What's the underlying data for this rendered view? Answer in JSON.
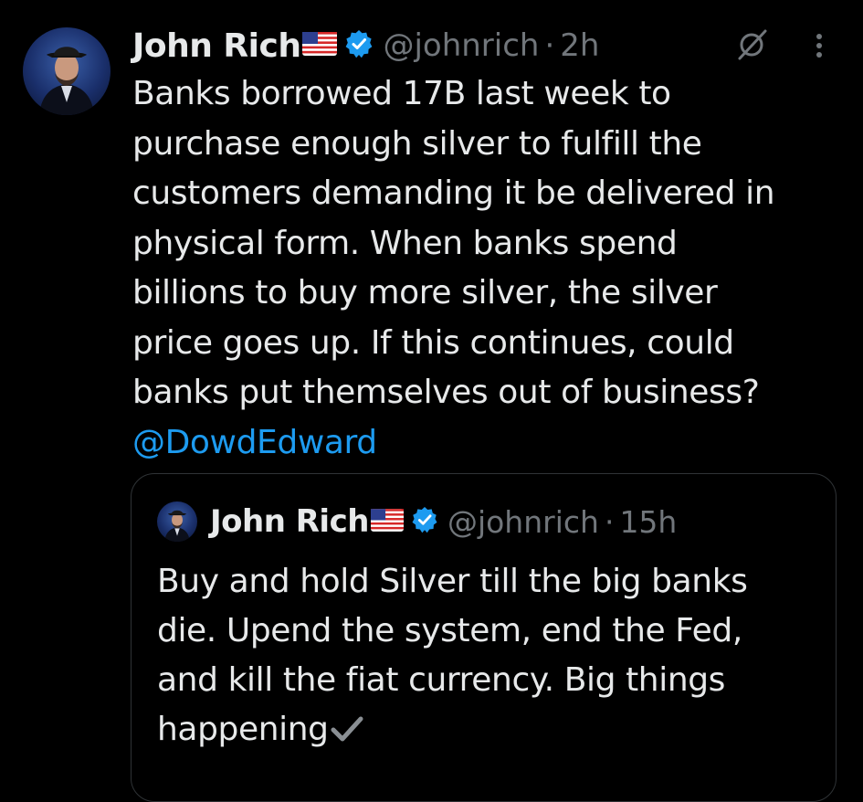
{
  "tweet": {
    "author_name": "John Rich",
    "author_handle": "@johnrich",
    "separator": "·",
    "time": "2h",
    "body_lines": [
      "Banks borrowed 17B last week to",
      "purchase enough silver to fulfill the",
      "customers demanding it be delivered in",
      "physical form. When banks spend",
      "billions to buy more silver, the silver",
      "price goes up. If this continues, could",
      "banks put themselves out of business?"
    ],
    "mention": "@DowdEdward"
  },
  "quoted_tweet": {
    "author_name": "John Rich",
    "author_handle": "@johnrich",
    "separator": "·",
    "time": "15h",
    "body_lines": [
      "Buy and hold Silver till the big banks",
      "die. Upend the system, end the Fed,",
      "and kill the fiat currency. Big things",
      "happening"
    ]
  },
  "icons": {
    "flag": "us-flag-icon",
    "verified": "verified-badge-icon",
    "grok": "grok-icon",
    "more": "more-options-icon",
    "check": "check-mark-icon"
  },
  "colors": {
    "background": "#000000",
    "text": "#e7e9ea",
    "muted": "#71767b",
    "link": "#1d9bf0",
    "verified": "#1d9bf0",
    "border": "#2f3336"
  }
}
